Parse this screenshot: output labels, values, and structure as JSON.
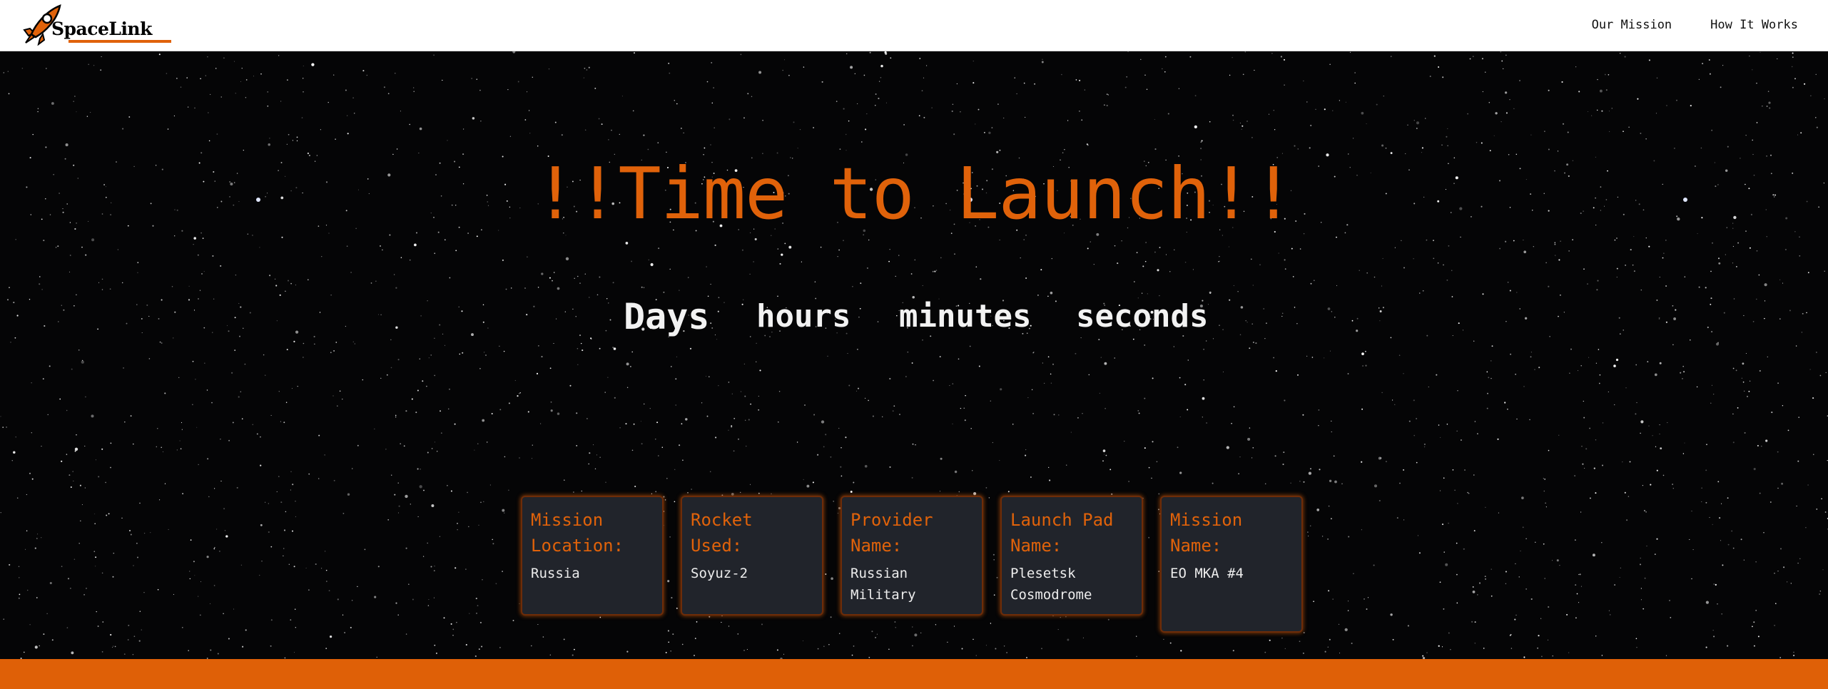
{
  "brand": {
    "name": "SpaceLink",
    "accent_color": "#e0620a",
    "logo_icon": "rocket-icon"
  },
  "nav": {
    "links": [
      "Our Mission",
      "How It Works"
    ]
  },
  "hero": {
    "title": "!!Time to Launch!!",
    "countdown": {
      "days": "Days",
      "hours": "hours",
      "minutes": "minutes",
      "seconds": "seconds"
    }
  },
  "cards": [
    {
      "label": "Mission Location:",
      "value": "Russia"
    },
    {
      "label": "Rocket Used:",
      "value": "Soyuz-2"
    },
    {
      "label": "Provider Name:",
      "value": "Russian Military"
    },
    {
      "label": "Launch Pad Name:",
      "value": "Plesetsk Cosmodrome"
    },
    {
      "label": "Mission Name:",
      "value": "EO MKA #4"
    }
  ],
  "colors": {
    "background": "#050506",
    "card_bg": "#21242b",
    "footer": "#df6007"
  }
}
